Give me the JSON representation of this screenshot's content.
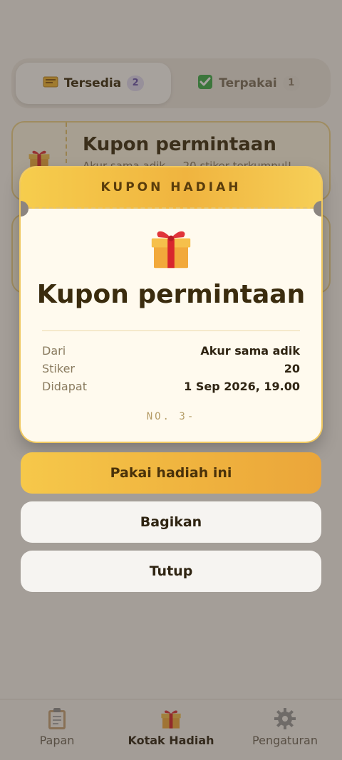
{
  "tabs": [
    {
      "icon": "ticket-icon",
      "label": "Tersedia",
      "count": "2"
    },
    {
      "icon": "check-icon",
      "label": "Terpakai",
      "count": "1"
    }
  ],
  "coupon_list": [
    {
      "title": "Kupon permintaan",
      "subtitle": "Akur sama adik — 20 stiker terkumpul!"
    },
    {
      "title": "",
      "subtitle": ""
    }
  ],
  "modal": {
    "header": "KUPON HADIAH",
    "icon": "gift-icon",
    "title": "Kupon permintaan",
    "details": [
      {
        "label": "Dari",
        "value": "Akur sama adik"
      },
      {
        "label": "Stiker",
        "value": "20"
      },
      {
        "label": "Didapat",
        "value": "1 Sep 2026, 19.00"
      }
    ],
    "serial": "NO. 3-",
    "buttons": {
      "use": "Pakai hadiah ini",
      "share": "Bagikan",
      "close": "Tutup"
    }
  },
  "nav": [
    {
      "icon": "clipboard-icon",
      "label": "Papan"
    },
    {
      "icon": "gift-icon",
      "label": "Kotak Hadiah",
      "active": true
    },
    {
      "icon": "gear-icon",
      "label": "Pengaturan"
    }
  ],
  "colors": {
    "accent": "#f0b43f",
    "ticket_bg": "#fffaee",
    "text_dark": "#3b2c0e"
  }
}
